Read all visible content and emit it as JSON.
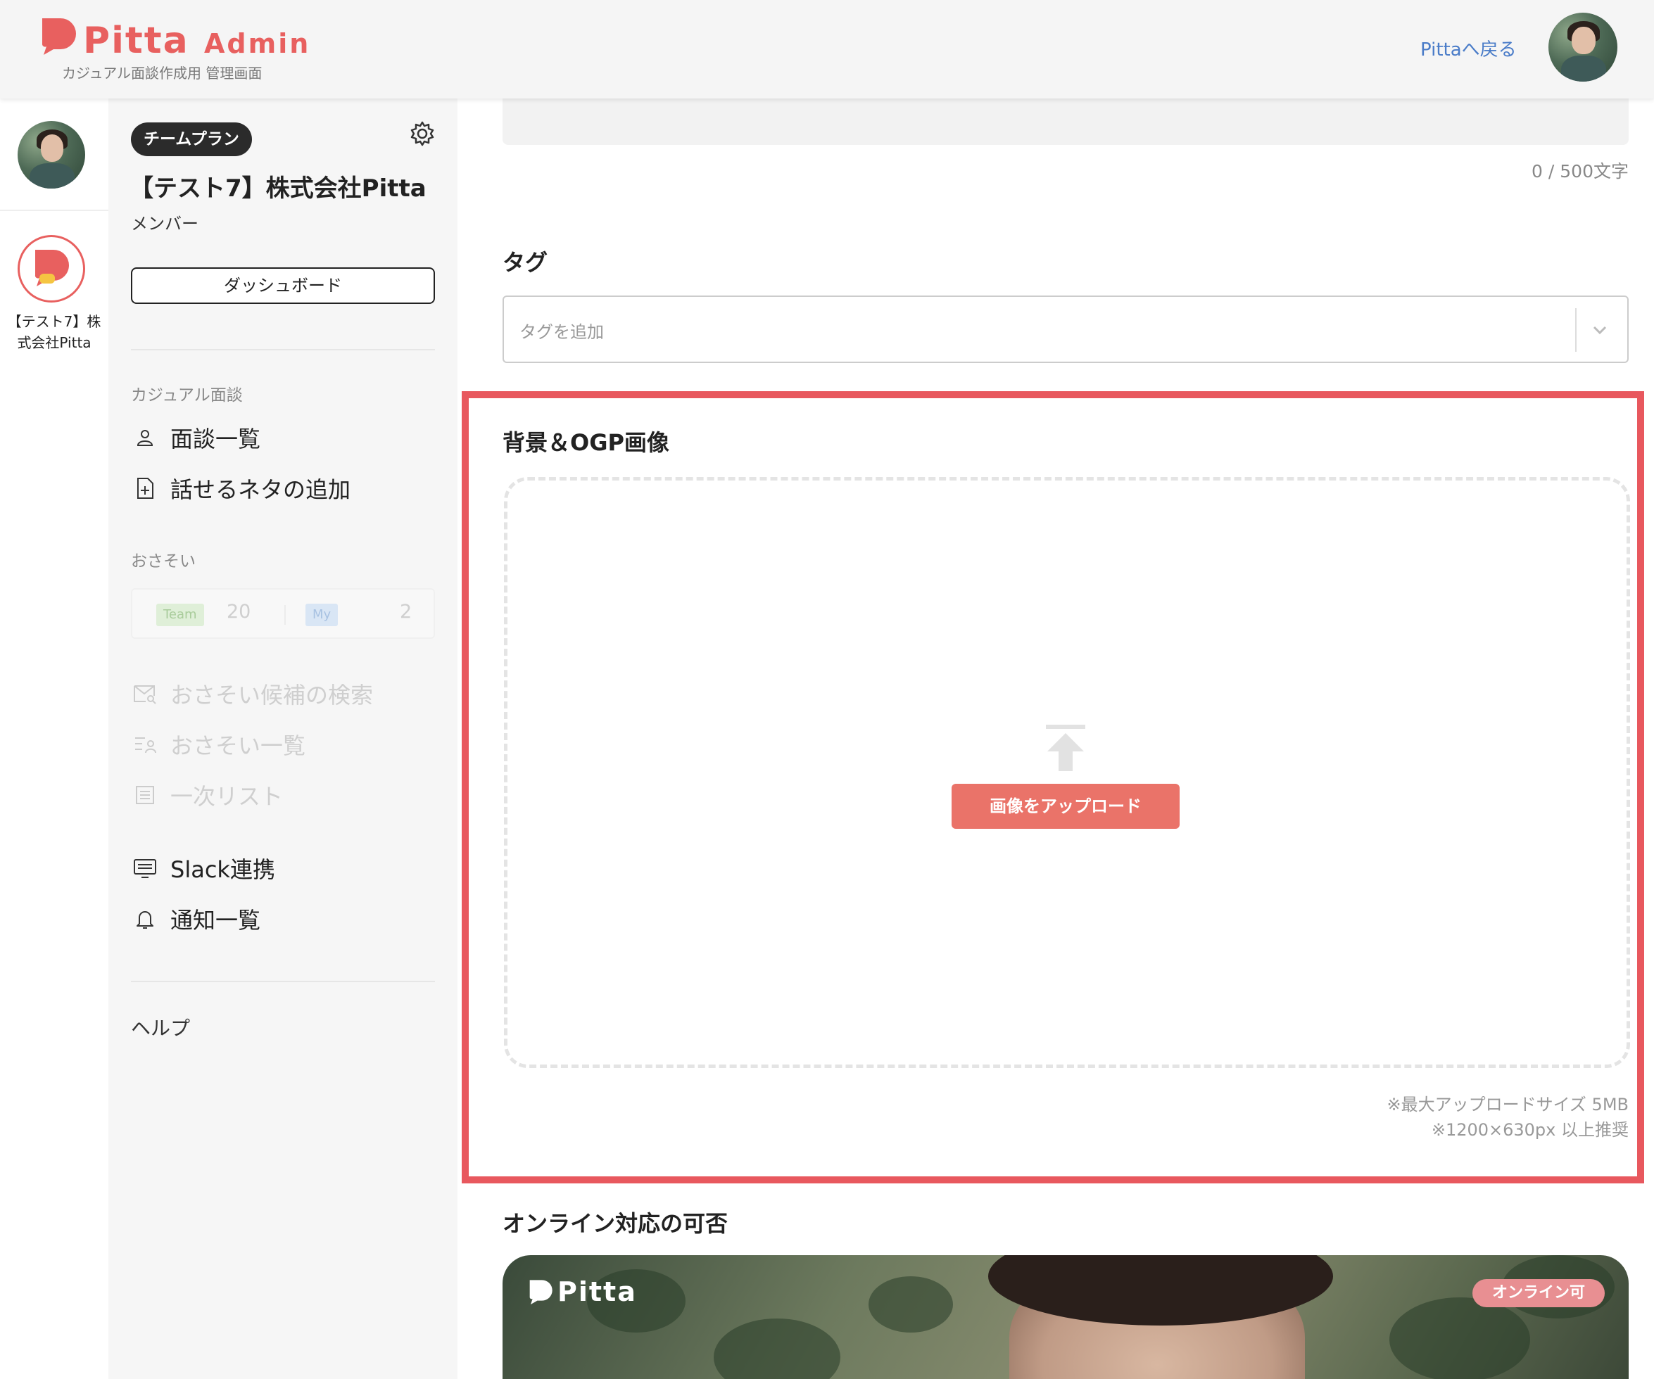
{
  "header": {
    "logo_text": "Pitta",
    "logo_admin": "Admin",
    "logo_subtitle": "カジュアル面談作成用 管理画面",
    "back_link": "Pittaへ戻る",
    "brand_color": "#e8605f"
  },
  "rail": {
    "org_label": "【テスト7】株式会社Pitta"
  },
  "sidebar": {
    "plan_badge": "チームプラン",
    "org_name": "【テスト7】株式会社Pitta",
    "role": "メンバー",
    "dashboard_button": "ダッシュボード",
    "section_casual": "カジュアル面談",
    "items_casual": [
      {
        "label": "面談一覧",
        "icon": "person-icon"
      },
      {
        "label": "話せるネタの追加",
        "icon": "doc-plus-icon"
      }
    ],
    "section_invite": "おさそい",
    "invite_counts": {
      "team_label": "Team",
      "team_count": "20",
      "my_label": "My",
      "my_count": "2"
    },
    "items_invite": [
      {
        "label": "おさそい候補の検索",
        "icon": "mail-search-icon"
      },
      {
        "label": "おさそい一覧",
        "icon": "list-person-icon"
      },
      {
        "label": "一次リスト",
        "icon": "list-icon"
      }
    ],
    "items_other": [
      {
        "label": "Slack連携",
        "icon": "monitor-icon"
      },
      {
        "label": "通知一覧",
        "icon": "bell-icon"
      }
    ],
    "help": "ヘルプ"
  },
  "main": {
    "char_count": "0 / 500文字",
    "tag_title": "タグ",
    "tag_placeholder": "タグを追加",
    "image_title": "背景＆OGP画像",
    "upload_button": "画像をアップロード",
    "note_size": "※最大アップロードサイズ 5MB",
    "note_dimensions": "※1200×630px 以上推奨",
    "online_title": "オンライン対応の可否",
    "card_logo": "Pitta",
    "card_badge": "オンライン可",
    "highlight_color": "#e8585e",
    "upload_button_color": "#ea7369"
  }
}
